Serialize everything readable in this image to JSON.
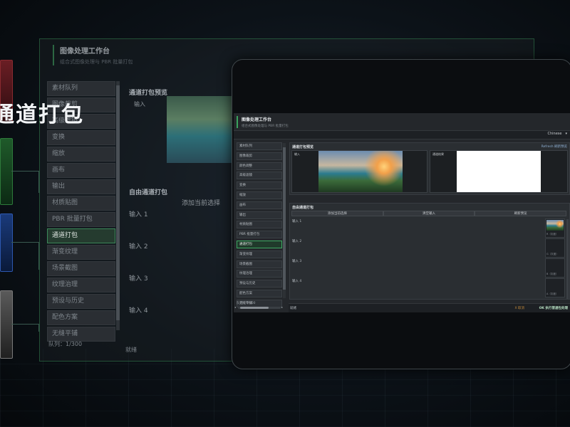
{
  "hero": {
    "title": "通道打包"
  },
  "app": {
    "title": "图像处理工作台",
    "subtitle": "组合式图像处理与 PBR 批量打包"
  },
  "language": {
    "selected": "Chinese"
  },
  "sidebar": {
    "items": [
      {
        "label": "素材队列"
      },
      {
        "label": "图像裁剪"
      },
      {
        "label": "颜色调整"
      },
      {
        "label": "高级滤镜"
      },
      {
        "label": "变换"
      },
      {
        "label": "缩放"
      },
      {
        "label": "画布"
      },
      {
        "label": "输出"
      },
      {
        "label": "材质贴图"
      },
      {
        "label": "PBR 批量打包"
      },
      {
        "label": "通道打包",
        "active": true
      },
      {
        "label": "渐变纹理"
      },
      {
        "label": "场景截图"
      },
      {
        "label": "纹理治理"
      },
      {
        "label": "预设与历史"
      },
      {
        "label": "配色方案"
      },
      {
        "label": "无缝平铺"
      }
    ],
    "queue_label": "队列：1/300"
  },
  "preview": {
    "title": "通道打包预览",
    "refresh_label": "Refresh 刷新预览",
    "input_label": "输入",
    "result_label": "通道结果"
  },
  "custom": {
    "title": "自由通道打包",
    "buttons": [
      "添加当前选择",
      "清空输入",
      "刷新预览"
    ],
    "inputs": [
      "输入 1",
      "输入 2",
      "输入 3",
      "输入 4"
    ],
    "slot_captions": [
      "R（灰度）",
      "G（灰度）",
      "B（灰度）",
      "A（灰度）"
    ]
  },
  "status": {
    "text": "就绪",
    "cancel_label": "X 取消",
    "run_label": "OK 执行普通包处理"
  },
  "background_window": {
    "title": "图像处理工作台",
    "subtitle": "组合式图像处理与 PBR 批量打包",
    "sidebar_items": [
      "素材队列",
      "图像裁剪",
      "高级滤镜",
      "变换",
      "缩放",
      "画布",
      "输出",
      "材质贴图",
      "PBR 批量打包",
      "通道打包",
      "渐变纹理",
      "场景截图",
      "纹理治理",
      "预设与历史",
      "配色方案",
      "无缝平铺"
    ],
    "preview_title": "通道打包预览",
    "input_label": "输入",
    "custom_title": "自由通道打包",
    "add_label": "添加当前选择",
    "inputs": [
      "输入 1",
      "输入 2",
      "输入 3",
      "输入 4"
    ],
    "queue_label": "队列：1/300",
    "status": "就绪"
  },
  "colors": {
    "accent": "#3da862",
    "background": "#0c1218",
    "panel": "#24272b"
  }
}
